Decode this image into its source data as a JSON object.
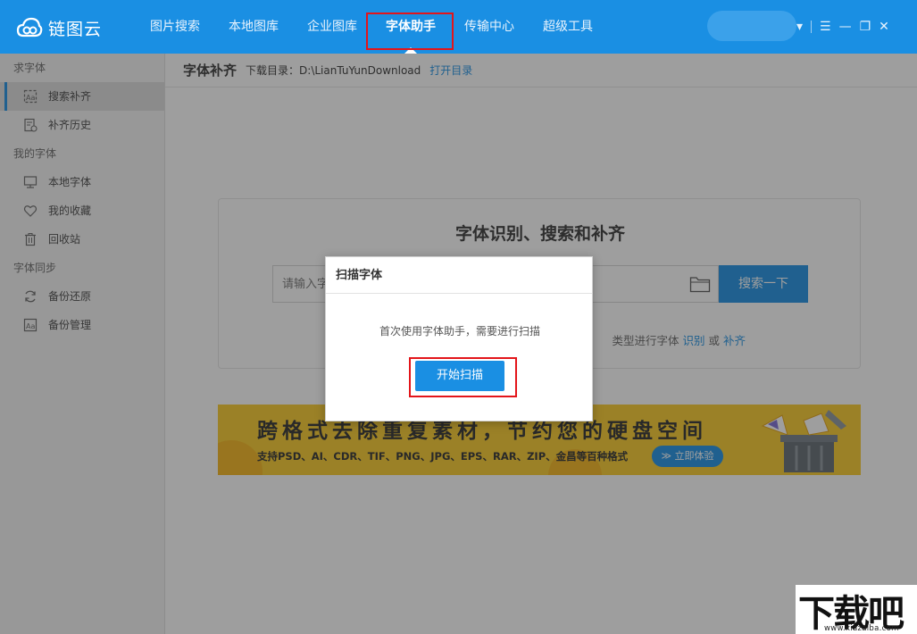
{
  "app": {
    "name": "链图云"
  },
  "nav": [
    {
      "label": "图片搜索"
    },
    {
      "label": "本地图库"
    },
    {
      "label": "企业图库"
    },
    {
      "label": "字体助手",
      "active": true
    },
    {
      "label": "传输中心"
    },
    {
      "label": "超级工具"
    }
  ],
  "window_controls": {
    "dropdown": "▾",
    "menu": "☰",
    "minimize": "—",
    "maximize": "❐",
    "close": "✕"
  },
  "sidebar": {
    "groups": [
      {
        "label": "求字体",
        "items": [
          {
            "label": "搜索补齐",
            "icon": "font-search-icon",
            "active": true
          },
          {
            "label": "补齐历史",
            "icon": "history-icon"
          }
        ]
      },
      {
        "label": "我的字体",
        "items": [
          {
            "label": "本地字体",
            "icon": "monitor-icon"
          },
          {
            "label": "我的收藏",
            "icon": "heart-icon"
          },
          {
            "label": "回收站",
            "icon": "trash-icon"
          }
        ]
      },
      {
        "label": "字体同步",
        "items": [
          {
            "label": "备份还原",
            "icon": "refresh-icon"
          },
          {
            "label": "备份管理",
            "icon": "font-manage-icon"
          }
        ]
      }
    ]
  },
  "header": {
    "title": "字体补齐",
    "download_label": "下载目录：",
    "download_path": "D:\\LianTuYunDownload",
    "open_dir": "打开目录"
  },
  "card": {
    "title": "字体识别、搜索和补齐",
    "search_placeholder": "请输入字",
    "search_button": "搜索一下",
    "hint_prefix": "类型进行字体",
    "hint_link1": "识别",
    "hint_or": "或",
    "hint_link2": "补齐"
  },
  "banner": {
    "title": "跨格式去除重复素材，节约您的硬盘空间",
    "subtitle": "支持PSD、AI、CDR、TIF、PNG、JPG、EPS、RAR、ZIP、金昌等百种格式",
    "button": "≫ 立即体验",
    "bg_color": "#f9cb27"
  },
  "dialog": {
    "title": "扫描字体",
    "message": "首次使用字体助手，需要进行扫描",
    "button": "开始扫描"
  },
  "watermark": {
    "text": "下载吧",
    "url": "www.xiazaiba.com"
  },
  "colors": {
    "primary": "#1a8fe3",
    "highlight_red": "#e3151a"
  }
}
